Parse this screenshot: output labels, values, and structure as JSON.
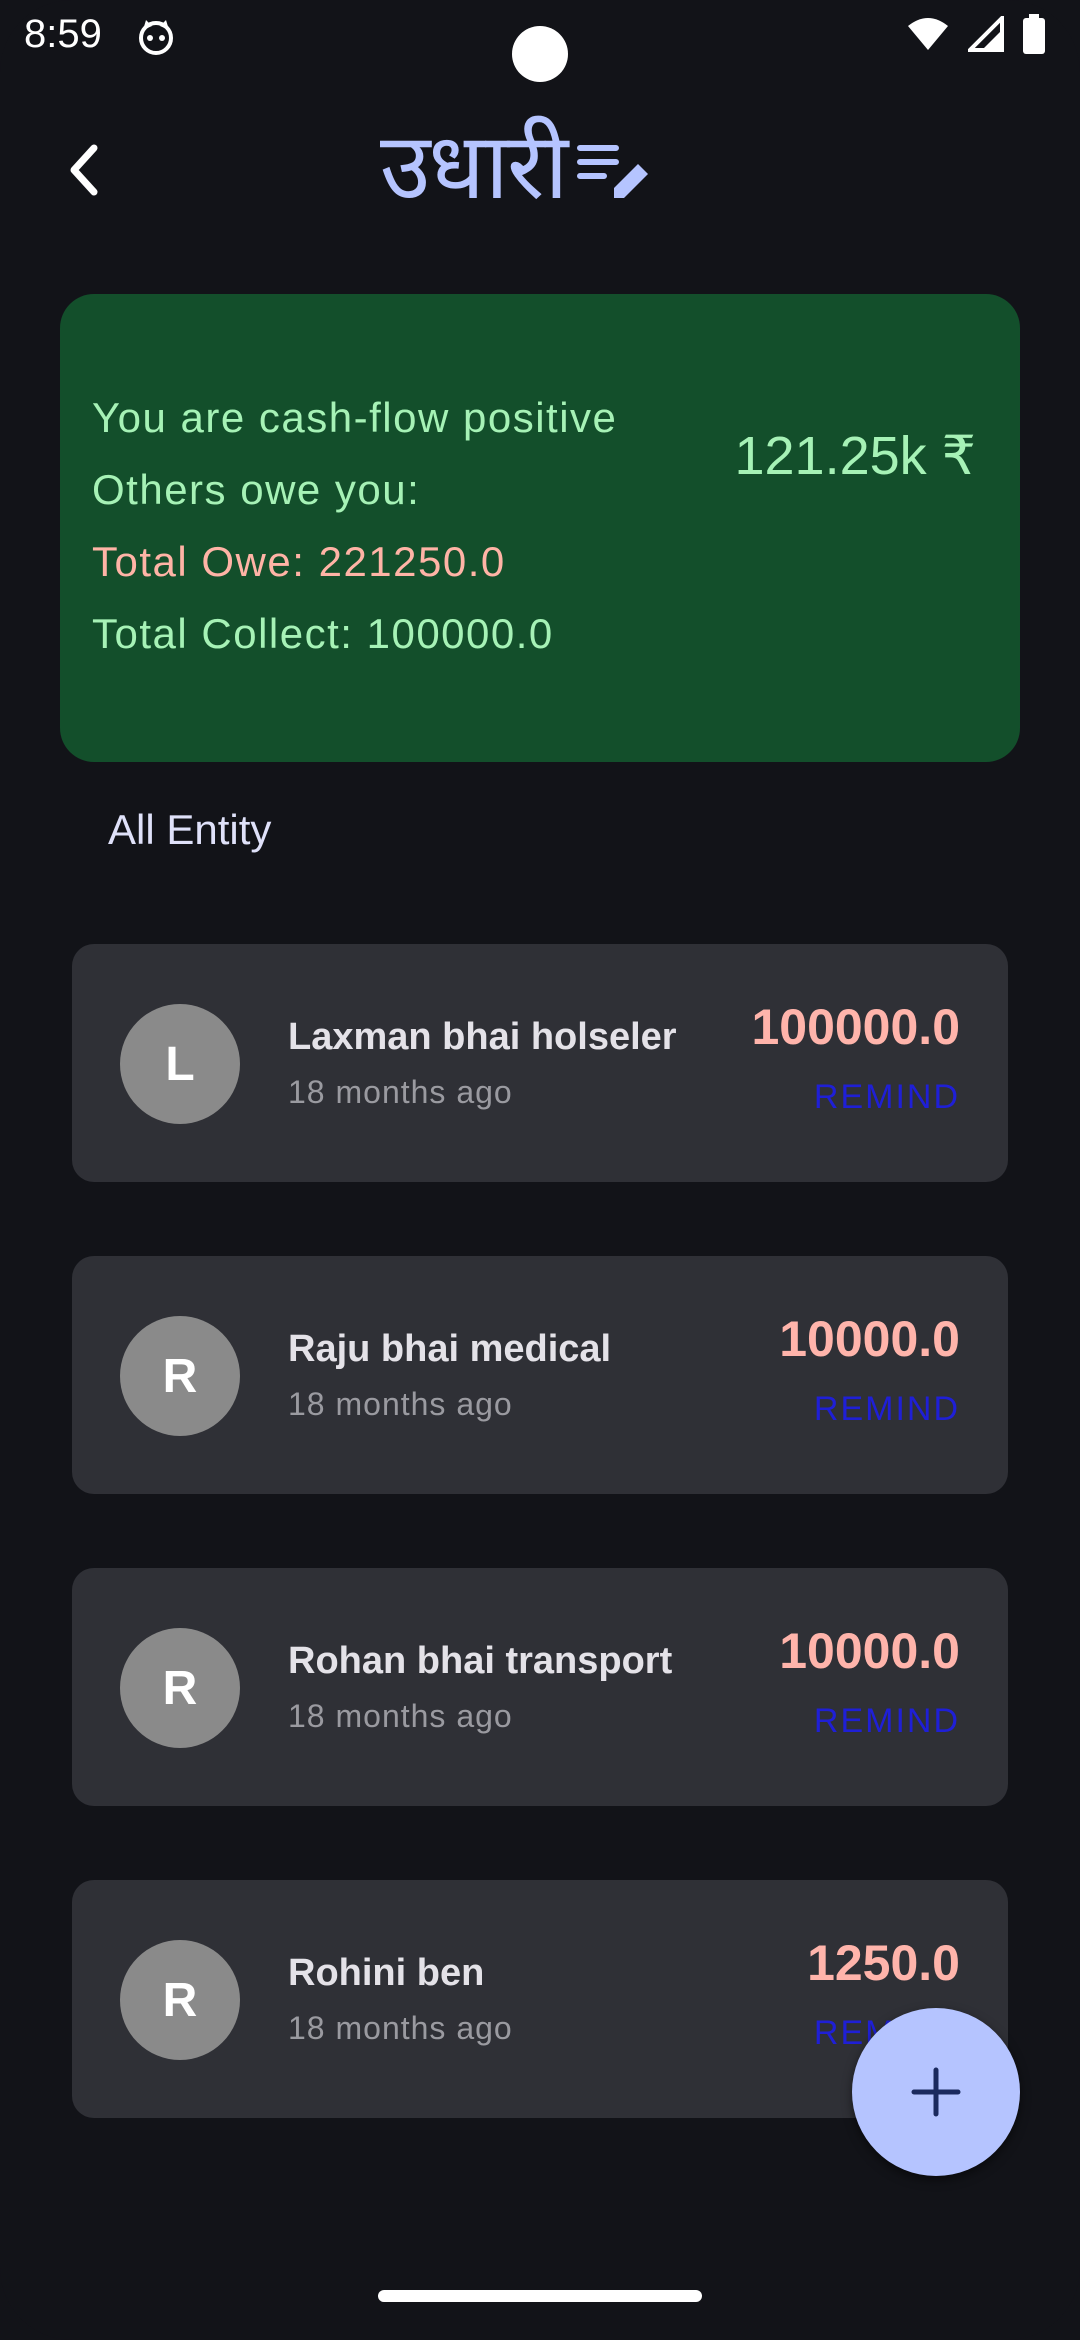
{
  "status": {
    "time": "8:59"
  },
  "header": {
    "title": "उधारी",
    "back_icon": "chevron-left-icon",
    "title_icon": "edit-note-icon"
  },
  "summary": {
    "line1": "You are cash-flow positive",
    "line2": "Others owe you:",
    "line3": "Total Owe: 221250.0",
    "line4": "Total Collect: 100000.0",
    "amount": "121.25k ₹",
    "colors": {
      "background": "#134f2b",
      "positive": "#a6f2b6",
      "owe": "#ffb4a6"
    }
  },
  "section_title": "All Entity",
  "entities": [
    {
      "initial": "L",
      "name": "Laxman bhai holseler",
      "time_ago": "18 months ago",
      "amount": "100000.0",
      "action": "REMIND"
    },
    {
      "initial": "R",
      "name": "Raju bhai medical",
      "time_ago": "18 months ago",
      "amount": "10000.0",
      "action": "REMIND"
    },
    {
      "initial": "R",
      "name": "Rohan bhai transport",
      "time_ago": "18 months ago",
      "amount": "10000.0",
      "action": "REMIND"
    },
    {
      "initial": "R",
      "name": "Rohini ben",
      "time_ago": "18 months ago",
      "amount": "1250.0",
      "action": "REMIND"
    }
  ],
  "fab": {
    "icon": "plus-icon"
  }
}
